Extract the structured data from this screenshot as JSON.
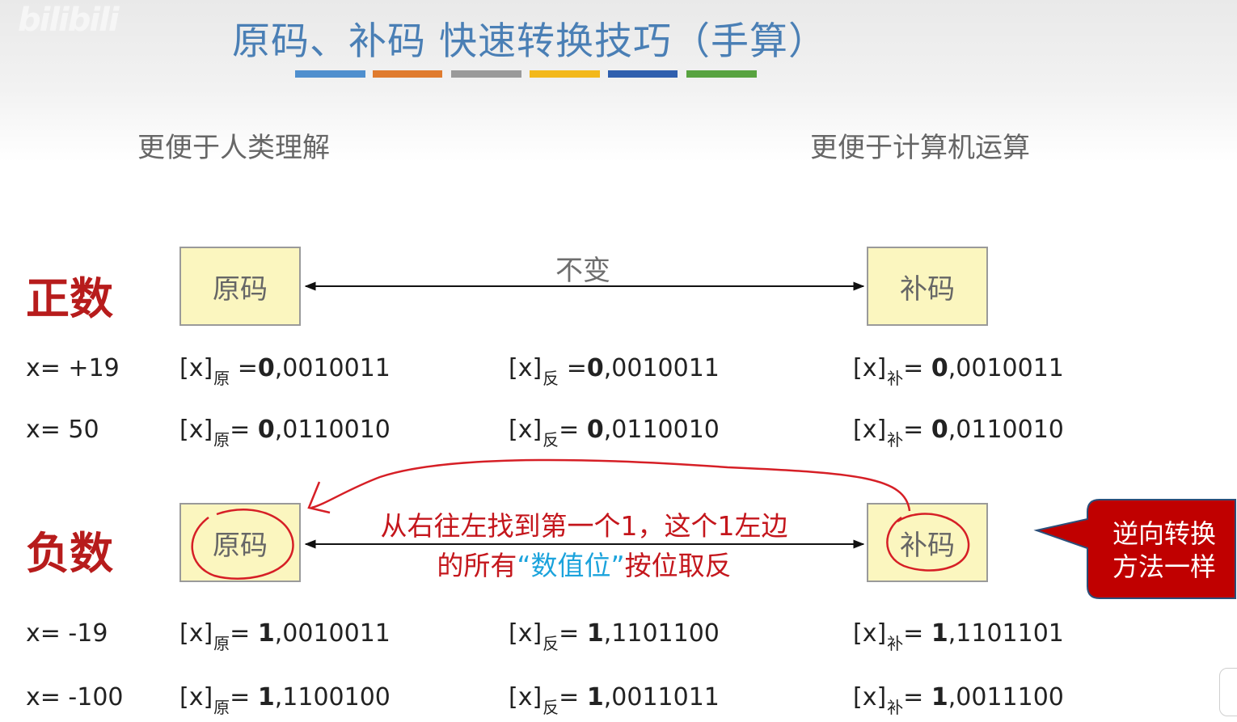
{
  "watermark": "bilibili",
  "title": "原码、补码 快速转换技巧（手算）",
  "title_bar_colors": [
    "#4f8fce",
    "#e07b2e",
    "#9a9a9a",
    "#f3b81b",
    "#2f5fae",
    "#58a340"
  ],
  "subheads": {
    "left": "更便于人类理解",
    "right": "更便于计算机运算"
  },
  "positive": {
    "label": "正数",
    "box_left": "原码",
    "box_right": "补码",
    "arrow_label": "不变",
    "rows": [
      {
        "x": "x= +19",
        "orig_bit": "0",
        "orig_rest": ",0010011",
        "ones_bit": "0",
        "ones_rest": ",0010011",
        "twos_bit": "0",
        "twos_rest": ",0010011"
      },
      {
        "x": "x= 50",
        "orig_bit": "0",
        "orig_rest": ",0110010",
        "ones_bit": "0",
        "ones_rest": ",0110010",
        "twos_bit": "0",
        "twos_rest": ",0110010"
      }
    ]
  },
  "negative": {
    "label": "负数",
    "box_left": "原码",
    "box_right": "补码",
    "note_line1": "从右往左找到第一个1，这个1左边",
    "note_line2_pre": "的所有",
    "note_line2_hl": "“数值位”",
    "note_line2_post": "按位取反",
    "callout_line1": "逆向转换",
    "callout_line2": "方法一样",
    "rows": [
      {
        "x": "x= -19",
        "orig_bit": "1",
        "orig_rest": ",0010011",
        "ones_bit": "1",
        "ones_rest": ",1101100",
        "twos_bit": "1",
        "twos_rest": ",1101101"
      },
      {
        "x": "x= -100",
        "orig_bit": "1",
        "orig_rest": ",1100100",
        "ones_bit": "1",
        "ones_rest": ",0011011",
        "twos_bit": "1",
        "twos_rest": ",0011100"
      }
    ]
  },
  "notation": {
    "prefix": "[x]",
    "orig_sub": "原",
    "ones_sub": "反",
    "twos_sub": "补",
    "eq": "="
  },
  "colors": {
    "title": "#4a7fb5",
    "section_label": "#b71c1c",
    "box_fill": "#fbf6bf",
    "annotation_red": "#d61f26",
    "highlight_blue": "#1ba3dc",
    "callout_fill": "#c00000"
  }
}
